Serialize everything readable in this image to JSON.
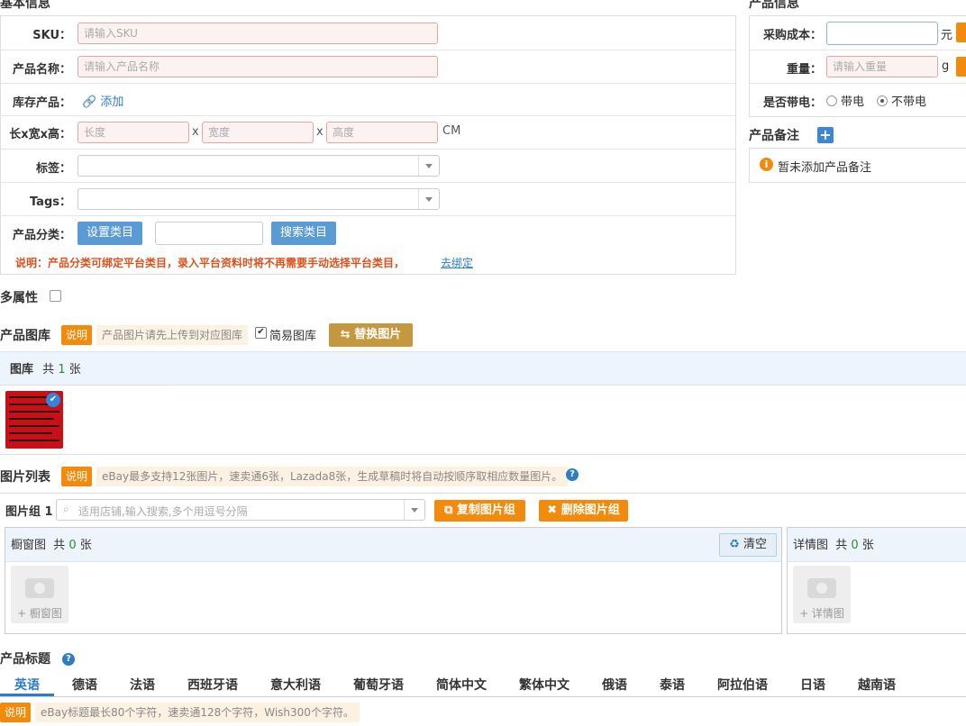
{
  "basic_info": {
    "title": "基本信息",
    "sku_label": "SKU：",
    "sku_placeholder": "请输入SKU",
    "name_label": "产品名称：",
    "name_placeholder": "请输入产品名称",
    "stock_label": "库存产品：",
    "stock_add": "添加",
    "dims_label": "长x宽x高：",
    "length_placeholder": "长度",
    "width_placeholder": "宽度",
    "height_placeholder": "高度",
    "x_sep": "x",
    "dims_unit": "CM",
    "tag_label": "标签：",
    "tags_label": "Tags：",
    "category_label": "产品分类：",
    "set_category": "设置类目",
    "search_category": "搜索类目",
    "note_text": "说明：产品分类可绑定平台类目，录入平台资料时将不再需要手动选择平台类目，",
    "note_link": "去绑定"
  },
  "product_info": {
    "title": "产品信息",
    "cost_label": "采购成本：",
    "cost_unit": "元",
    "weight_label": "重量：",
    "weight_placeholder": "请输入重量",
    "weight_unit": "g",
    "battery_label": "是否带电：",
    "battery_yes": "带电",
    "battery_no": "不带电"
  },
  "product_remark": {
    "title": "产品备注",
    "empty_text": "暂未添加产品备注"
  },
  "multi_attr": {
    "label": "多属性"
  },
  "gallery": {
    "title": "产品图库",
    "badge": "说明",
    "tip": "产品图片请先上传到对应图库",
    "simple_label": "简易图库",
    "replace_btn": "替换图片",
    "lib_label": "图库",
    "total_prefix": "共",
    "count": "1",
    "total_suffix": "张"
  },
  "image_list": {
    "title": "图片列表",
    "badge": "说明",
    "tip": "eBay最多支持12张图片，速卖通6张，Lazada8张，生成草稿时将自动按顺序取相应数量图片。",
    "group_label": "图片组 1",
    "group_placeholder": "适用店铺,输入搜索,多个用逗号分隔",
    "copy_btn": "复制图片组",
    "delete_btn": "删除图片组",
    "window_label": "橱窗图",
    "window_prefix": "共",
    "window_count": "0",
    "window_suffix": "张",
    "clear_btn": "清空",
    "window_add": "+ 橱窗图",
    "detail_label": "详情图",
    "detail_prefix": "共",
    "detail_count": "0",
    "detail_suffix": "张",
    "detail_add": "+ 详情图"
  },
  "product_title": {
    "title": "产品标题",
    "tabs": [
      "英语",
      "德语",
      "法语",
      "西班牙语",
      "意大利语",
      "葡萄牙语",
      "简体中文",
      "繁体中文",
      "俄语",
      "泰语",
      "阿拉伯语",
      "日语",
      "越南语"
    ],
    "badge": "说明",
    "tip": "eBay标题最长80个字符，速卖通128个字符，Wish300个字符。"
  },
  "colors": {
    "accent_blue": "#5b9bd5",
    "orange": "#f28a0c",
    "gold": "#c5973e"
  }
}
